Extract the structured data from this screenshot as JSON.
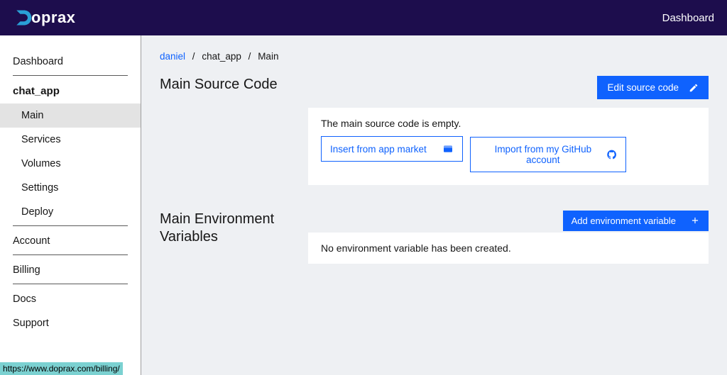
{
  "brand": {
    "name": "oprax"
  },
  "topnav": {
    "dashboard": "Dashboard"
  },
  "sidebar": {
    "dashboard": "Dashboard",
    "app_name": "chat_app",
    "items": [
      "Main",
      "Services",
      "Volumes",
      "Settings",
      "Deploy"
    ],
    "account": "Account",
    "billing": "Billing",
    "docs": "Docs",
    "support": "Support"
  },
  "breadcrumb": {
    "user": "daniel",
    "app": "chat_app",
    "page": "Main"
  },
  "source": {
    "title": "Main Source Code",
    "edit_btn": "Edit source code",
    "empty_msg": "The main source code is empty.",
    "insert_market": "Insert from app market",
    "import_github": "Import from my GitHub account"
  },
  "env": {
    "title": "Main Environment Variables",
    "add_btn": "Add environment variable",
    "empty_msg": "No environment variable has been created."
  },
  "status_url": "https://www.doprax.com/billing/"
}
